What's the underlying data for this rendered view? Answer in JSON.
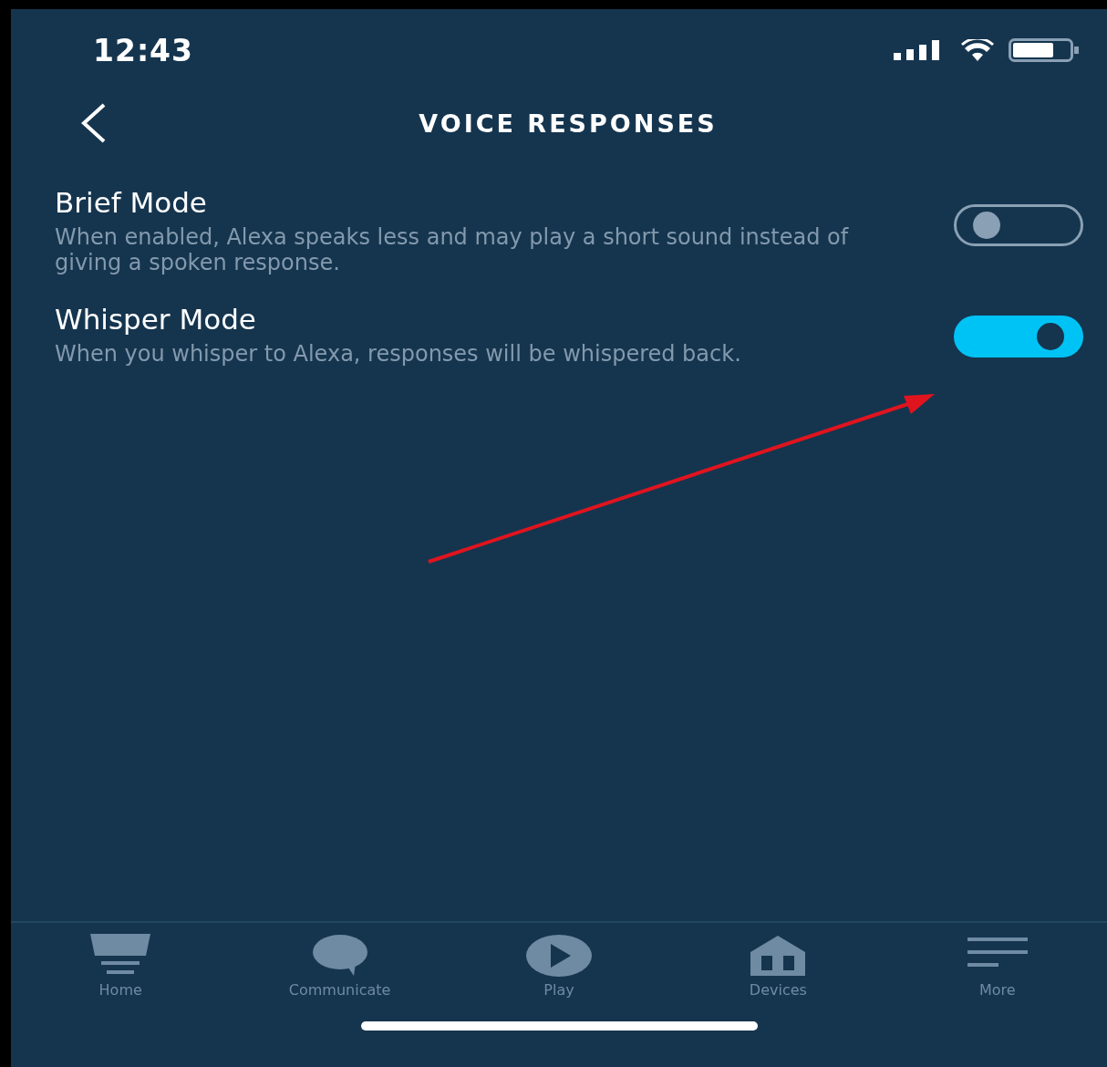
{
  "status_bar": {
    "time": "12:43"
  },
  "header": {
    "title": "VOICE RESPONSES"
  },
  "settings": [
    {
      "title": "Brief Mode",
      "description": "When enabled, Alexa speaks less and may play a short sound instead of giving a spoken response.",
      "on": false
    },
    {
      "title": "Whisper Mode",
      "description": "When you whisper to Alexa, responses will be whispered back.",
      "on": true
    }
  ],
  "tab_bar": [
    {
      "label": "Home"
    },
    {
      "label": "Communicate"
    },
    {
      "label": "Play"
    },
    {
      "label": "Devices"
    },
    {
      "label": "More"
    }
  ]
}
